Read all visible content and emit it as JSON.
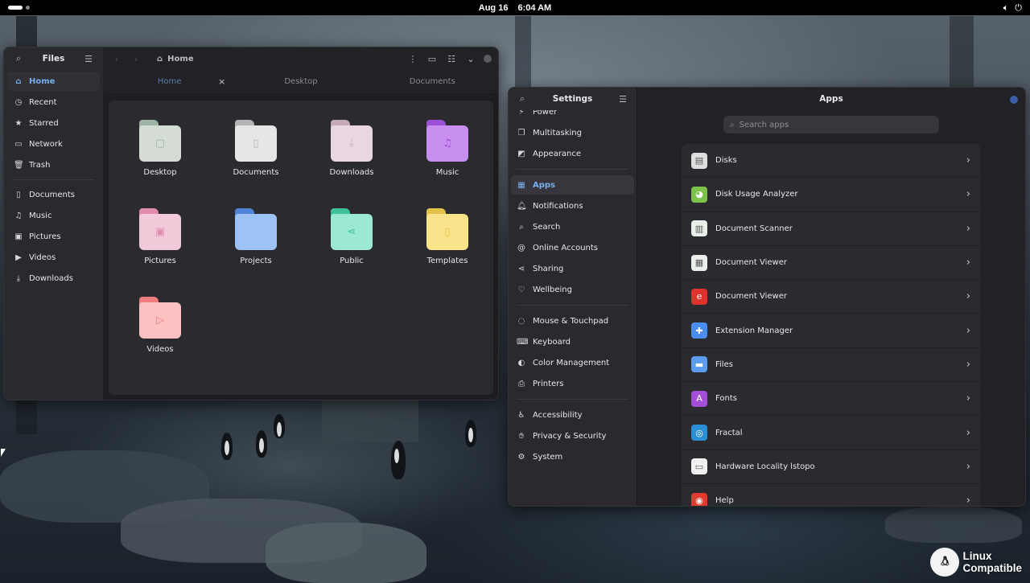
{
  "topbar": {
    "date": "Aug 16",
    "time": "6:04 AM",
    "volume_icon": "speaker-icon",
    "power_icon": "power-icon"
  },
  "files": {
    "sidebar_title": "Files",
    "sidebar_items": [
      {
        "label": "Home",
        "icon": "home-icon"
      },
      {
        "label": "Recent",
        "icon": "clock-icon"
      },
      {
        "label": "Starred",
        "icon": "star-icon"
      },
      {
        "label": "Network",
        "icon": "network-icon"
      },
      {
        "label": "Trash",
        "icon": "trash-icon"
      }
    ],
    "bookmark_items": [
      {
        "label": "Documents",
        "icon": "document-icon"
      },
      {
        "label": "Music",
        "icon": "music-icon"
      },
      {
        "label": "Pictures",
        "icon": "picture-icon"
      },
      {
        "label": "Videos",
        "icon": "video-icon"
      },
      {
        "label": "Downloads",
        "icon": "download-icon"
      }
    ],
    "path": "Home",
    "tabs": [
      "Home",
      "Desktop",
      "Documents"
    ],
    "folders": [
      {
        "label": "Desktop",
        "color": "#d5dcd6",
        "tab_color": "#9fb3a5",
        "glyph": "▢"
      },
      {
        "label": "Documents",
        "color": "#e6e6e6",
        "tab_color": "#b4b4b4",
        "glyph": "▯"
      },
      {
        "label": "Downloads",
        "color": "#e8d7e0",
        "tab_color": "#c6a9b8",
        "glyph": "⤓"
      },
      {
        "label": "Music",
        "color": "#c88ef0",
        "tab_color": "#9a4fd6",
        "glyph": "♫"
      },
      {
        "label": "Pictures",
        "color": "#f2c9d8",
        "tab_color": "#e28bb0",
        "glyph": "▣"
      },
      {
        "label": "Projects",
        "color": "#9dc2f5",
        "tab_color": "#4f84d8",
        "glyph": ""
      },
      {
        "label": "Public",
        "color": "#9be8d3",
        "tab_color": "#3fbf9b",
        "glyph": "⋖"
      },
      {
        "label": "Templates",
        "color": "#fbe38c",
        "tab_color": "#e3c24a",
        "glyph": "▯"
      },
      {
        "label": "Videos",
        "color": "#fcc1c1",
        "tab_color": "#f07d7d",
        "glyph": "▷"
      }
    ]
  },
  "settings": {
    "sidebar_title": "Settings",
    "main_title": "Apps",
    "search_placeholder": "Search apps",
    "items_group1": [
      {
        "label": "Power",
        "icon": "power-mode-icon"
      },
      {
        "label": "Multitasking",
        "icon": "multitasking-icon"
      },
      {
        "label": "Appearance",
        "icon": "appearance-icon"
      }
    ],
    "items_group2": [
      {
        "label": "Apps",
        "icon": "apps-icon"
      },
      {
        "label": "Notifications",
        "icon": "bell-icon"
      },
      {
        "label": "Search",
        "icon": "search-icon"
      },
      {
        "label": "Online Accounts",
        "icon": "at-icon"
      },
      {
        "label": "Sharing",
        "icon": "share-icon"
      },
      {
        "label": "Wellbeing",
        "icon": "wellbeing-icon"
      }
    ],
    "items_group3": [
      {
        "label": "Mouse & Touchpad",
        "icon": "mouse-icon"
      },
      {
        "label": "Keyboard",
        "icon": "keyboard-icon"
      },
      {
        "label": "Color Management",
        "icon": "color-icon"
      },
      {
        "label": "Printers",
        "icon": "printer-icon"
      }
    ],
    "items_group4": [
      {
        "label": "Accessibility",
        "icon": "accessibility-icon"
      },
      {
        "label": "Privacy & Security",
        "icon": "hand-icon"
      },
      {
        "label": "System",
        "icon": "gear-icon"
      }
    ],
    "apps": [
      {
        "label": "Disks",
        "icon": "disks-icon",
        "color": "#dedede",
        "glyph": "▤"
      },
      {
        "label": "Disk Usage Analyzer",
        "icon": "disk-usage-icon",
        "color": "#7cc34b",
        "glyph": "◕"
      },
      {
        "label": "Document Scanner",
        "icon": "scanner-icon",
        "color": "#e9efe9",
        "glyph": "▥"
      },
      {
        "label": "Document Viewer",
        "icon": "document-viewer-icon",
        "color": "#ecf0ec",
        "glyph": "▦"
      },
      {
        "label": "Document Viewer",
        "icon": "document-viewer-red-icon",
        "color": "#e0322c",
        "glyph": "e"
      },
      {
        "label": "Extension Manager",
        "icon": "puzzle-icon",
        "color": "#4a8df0",
        "glyph": "✚"
      },
      {
        "label": "Files",
        "icon": "files-icon",
        "color": "#5b9df2",
        "glyph": "▬"
      },
      {
        "label": "Fonts",
        "icon": "fonts-icon",
        "color": "#a24fd6",
        "glyph": "A"
      },
      {
        "label": "Fractal",
        "icon": "fractal-icon",
        "color": "#2b8fd6",
        "glyph": "◎"
      },
      {
        "label": "Hardware Locality lstopo",
        "icon": "hwloc-icon",
        "color": "#f1f1f1",
        "glyph": "▭"
      },
      {
        "label": "Help",
        "icon": "lifebuoy-icon",
        "color": "#e43a2f",
        "glyph": "◉"
      }
    ]
  },
  "watermark": {
    "line1": "Linux",
    "line2": "Compatible"
  }
}
